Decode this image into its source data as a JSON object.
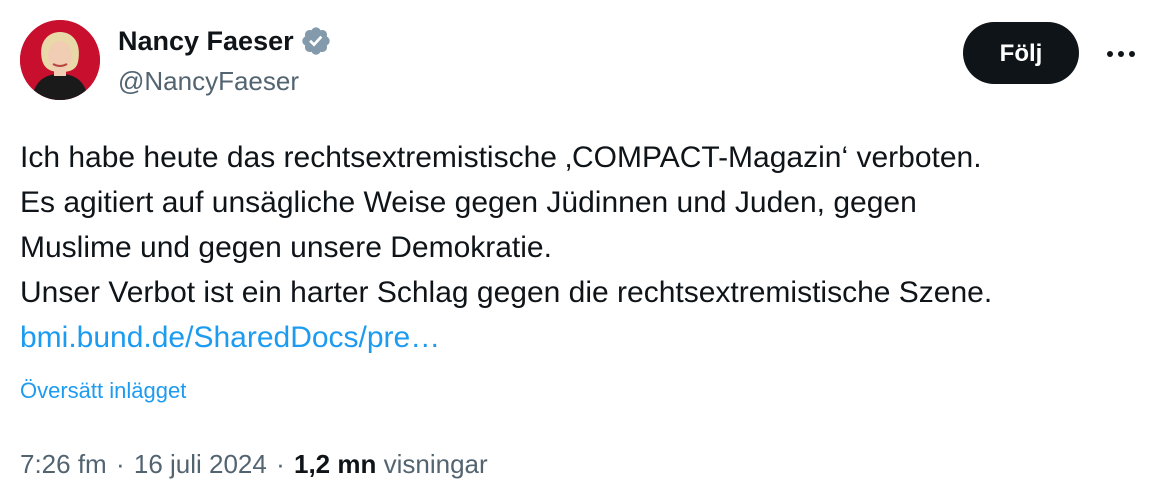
{
  "author": {
    "display_name": "Nancy Faeser",
    "handle": "@NancyFaeser",
    "verified": true,
    "verified_icon": "verified-badge-icon",
    "verified_color": "#829aab"
  },
  "actions": {
    "follow_label": "Följ",
    "more_icon": "ellipsis-icon"
  },
  "tweet": {
    "lines": [
      "Ich habe heute das rechtsextremistische ‚COMPACT-Magazin‘ verboten.",
      "Es agitiert auf unsägliche Weise gegen Jüdinnen und Juden, gegen",
      "Muslime und gegen unsere Demokratie.",
      "Unser Verbot ist ein harter Schlag gegen die rechtsextremistische Szene."
    ],
    "link_text": "bmi.bund.de/SharedDocs/pre…",
    "translate_label": "Översätt inlägget"
  },
  "meta": {
    "time": "7:26 fm",
    "separator": "·",
    "date": "16 juli 2024",
    "views_count": "1,2 mn",
    "views_label": "visningar"
  },
  "colors": {
    "text": "#0f1419",
    "secondary": "#536471",
    "link": "#1d9bf0",
    "button_bg": "#0f1419",
    "avatar_bg": "#c8102e"
  }
}
